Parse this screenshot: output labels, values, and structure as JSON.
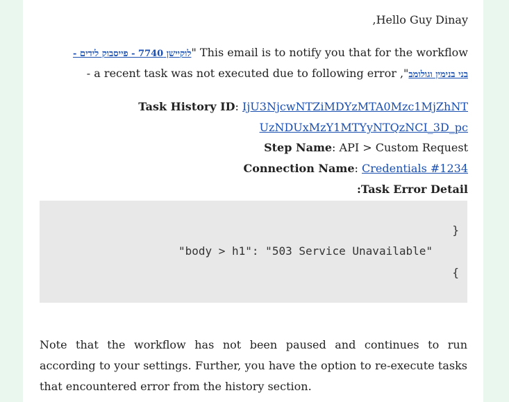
{
  "email": {
    "greeting": "Hello Guy Dinay,",
    "intro_text_1": " This email is to notify you that for the workflow \"",
    "workflow_link_part1": "לוקיישן 7740 - פייסבוק לידים - ",
    "workflow_link_part2": "בני בנימין וגולומב",
    "intro_text_2": "\", a recent task was not executed due to following error -",
    "task_history_label": "Task History ID",
    "task_history_value_line1": "IjU3NjcwNTZiMDYzMTA0Mzc1MjZhNT",
    "task_history_value_line2": "UzNDUxMzY1MTYyNTQzNCI_3D_pc",
    "step_name_label": "Step Name",
    "step_name_value": "API > Custom Request",
    "connection_name_label": "Connection Name",
    "connection_name_value": "Credentials #1234",
    "task_error_detail_label": "Task Error Detail:",
    "code_line_1": "}",
    "code_line_2": "\"body > h1\": \"503 Service Unavailable\"",
    "code_line_3": "{",
    "footer_paragraph": "Note that the workflow has not been paused and continues to run according to your settings. Further, you have the option to re-execute tasks that encountered error from the history section."
  }
}
